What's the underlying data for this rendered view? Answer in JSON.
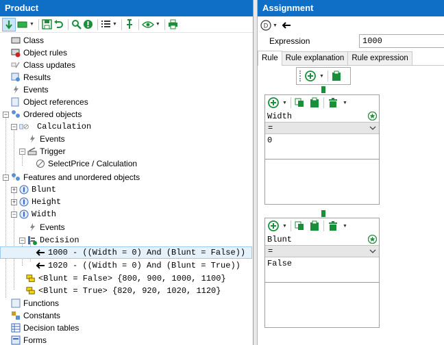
{
  "product_panel": {
    "title": "Product",
    "toolbar": [
      "arrow-down-icon",
      "rectangle-dropdown-icon",
      "save-icon",
      "undo-icon",
      "search-icon",
      "warning-icon",
      "list-dropdown-icon",
      "pin-icon",
      "view-dropdown-icon",
      "print-icon"
    ],
    "tree": [
      {
        "label": "Class",
        "icon": "class-icon",
        "level": 0
      },
      {
        "label": "Object rules",
        "icon": "object-rules-icon",
        "level": 0
      },
      {
        "label": "Class updates",
        "icon": "class-updates-icon",
        "level": 0
      },
      {
        "label": "Results",
        "icon": "results-icon",
        "level": 0
      },
      {
        "label": "Events",
        "icon": "events-icon",
        "level": 0
      },
      {
        "label": "Object references",
        "icon": "object-references-icon",
        "level": 0
      },
      {
        "label": "Ordered objects",
        "icon": "ordered-objects-icon",
        "level": 0
      },
      {
        "label": "Calculation",
        "icon": "calculation-icon",
        "level": 1
      },
      {
        "label": "Events",
        "icon": "events-icon",
        "level": 2
      },
      {
        "label": "Trigger",
        "icon": "trigger-icon",
        "level": 2
      },
      {
        "label": "SelectPrice / Calculation",
        "icon": "select-price-icon",
        "level": 3
      },
      {
        "label": "Features and unordered objects",
        "icon": "features-icon",
        "level": 0
      },
      {
        "label": "Blunt",
        "icon": "feature-icon",
        "level": 1
      },
      {
        "label": "Height",
        "icon": "feature-icon",
        "level": 1
      },
      {
        "label": "Width",
        "icon": "feature-icon",
        "level": 1
      },
      {
        "label": "Events",
        "icon": "events-icon",
        "level": 2
      },
      {
        "label": "Decision",
        "icon": "decision-icon",
        "level": 2
      },
      {
        "label": "1000 - ((Width = 0) And (Blunt = False))",
        "icon": "assignment-arrow-icon",
        "level": 3
      },
      {
        "label": "1020 - ((Width = 0) And (Blunt = True))",
        "icon": "assignment-arrow-icon",
        "level": 3
      },
      {
        "label": "<Blunt = False> {800, 900, 1000, 1100}",
        "icon": "domain-icon",
        "level": 2
      },
      {
        "label": "<Blunt = True> {820, 920, 1020, 1120}",
        "icon": "domain-icon",
        "level": 2
      },
      {
        "label": "Functions",
        "icon": "functions-icon",
        "level": 0
      },
      {
        "label": "Constants",
        "icon": "constants-icon",
        "level": 0
      },
      {
        "label": "Decision tables",
        "icon": "decision-tables-icon",
        "level": 0
      },
      {
        "label": "Forms",
        "icon": "forms-icon",
        "level": 0
      }
    ]
  },
  "assignment_panel": {
    "title": "Assignment",
    "expression_label": "Expression",
    "expression_value": "1000",
    "tabs": [
      "Rule",
      "Rule explanation",
      "Rule expression"
    ],
    "active_tab": "Rule",
    "conditions": [
      {
        "feature": "Width",
        "operator": "=",
        "value": "0"
      },
      {
        "feature": "Blunt",
        "operator": "=",
        "value": "False"
      }
    ]
  },
  "colors": {
    "header_blue": "#0f6fc6",
    "selection": "#e5f1fb",
    "green": "#1a8f3a"
  }
}
